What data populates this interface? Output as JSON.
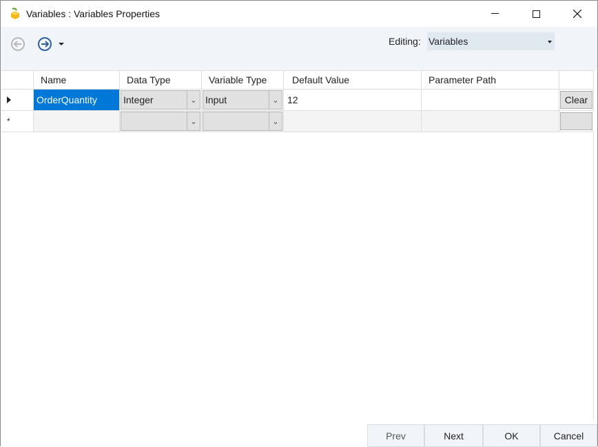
{
  "window": {
    "title": "Variables : Variables Properties"
  },
  "toolbar": {
    "editing_label": "Editing:",
    "editing_value": "Variables"
  },
  "grid": {
    "columns": [
      "Name",
      "Data Type",
      "Variable Type",
      "Default Value",
      "Parameter Path"
    ],
    "rows": [
      {
        "name": "OrderQuantity",
        "data_type": "Integer",
        "variable_type": "Input",
        "default_value": "12",
        "parameter_path": "",
        "action": "Clear"
      }
    ],
    "new_row_marker": "*"
  },
  "footer": {
    "prev": "Prev",
    "next": "Next",
    "ok": "OK",
    "cancel": "Cancel"
  },
  "colors": {
    "selection": "#0078d7",
    "toolbar_bg": "#f1f4f8"
  }
}
